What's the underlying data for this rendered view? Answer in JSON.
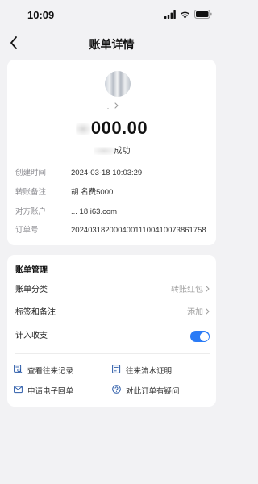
{
  "status_bar": {
    "time": "10:09",
    "icons": [
      "signal-icon",
      "wifi-icon",
      "battery-icon"
    ]
  },
  "nav": {
    "title": "账单详情",
    "back_icon": "chevron-left-icon"
  },
  "transaction": {
    "payee_name": "...",
    "amount": "000.00",
    "status": "成功",
    "details": [
      {
        "label": "创建时间",
        "value": "2024-03-18 10:03:29"
      },
      {
        "label": "转账备注",
        "value": "胡 名费5000"
      },
      {
        "label": "对方账户",
        "value": "... 18 i63.com"
      },
      {
        "label": "订单号",
        "value": "20240318200040011100410073861758"
      }
    ]
  },
  "management": {
    "title": "账单管理",
    "rows": [
      {
        "label": "账单分类",
        "value": "转账红包"
      },
      {
        "label": "标签和备注",
        "value": "添加"
      },
      {
        "label": "计入收支",
        "toggle_on": true
      }
    ],
    "links": [
      {
        "label": "查看往来记录",
        "icon": "records-search-icon"
      },
      {
        "label": "往来流水证明",
        "icon": "statement-proof-icon"
      },
      {
        "label": "申请电子回单",
        "icon": "mail-icon"
      },
      {
        "label": "对此订单有疑问",
        "icon": "question-circle-icon"
      }
    ]
  },
  "colors": {
    "accent": "#2a7bf6",
    "background": "#f2f2f4",
    "card": "#ffffff",
    "muted_text": "#8e8e93"
  }
}
